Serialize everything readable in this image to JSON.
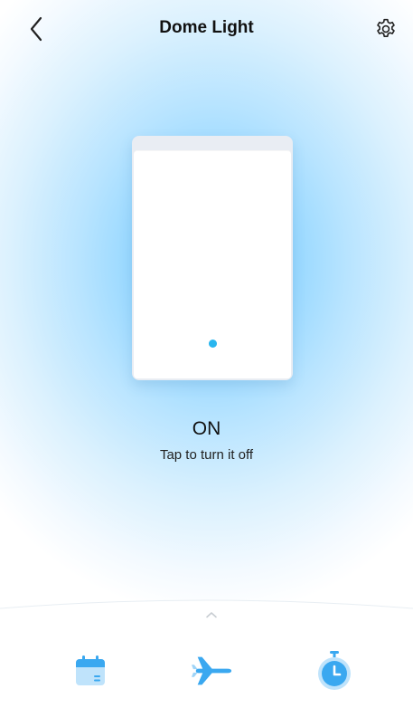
{
  "header": {
    "title": "Dome Light",
    "back_icon": "chevron-left-icon",
    "settings_icon": "gear-icon"
  },
  "device": {
    "state": "ON",
    "hint": "Tap to turn it off",
    "led_color": "#29b6ef"
  },
  "bottom_bar": {
    "handle_icon": "chevron-up-icon",
    "actions": [
      {
        "name": "schedule",
        "icon": "calendar-icon"
      },
      {
        "name": "away-mode",
        "icon": "airplane-icon"
      },
      {
        "name": "timer",
        "icon": "stopwatch-icon"
      }
    ]
  },
  "colors": {
    "accent": "#3aa8f0",
    "glow": "#6cc8ff"
  }
}
